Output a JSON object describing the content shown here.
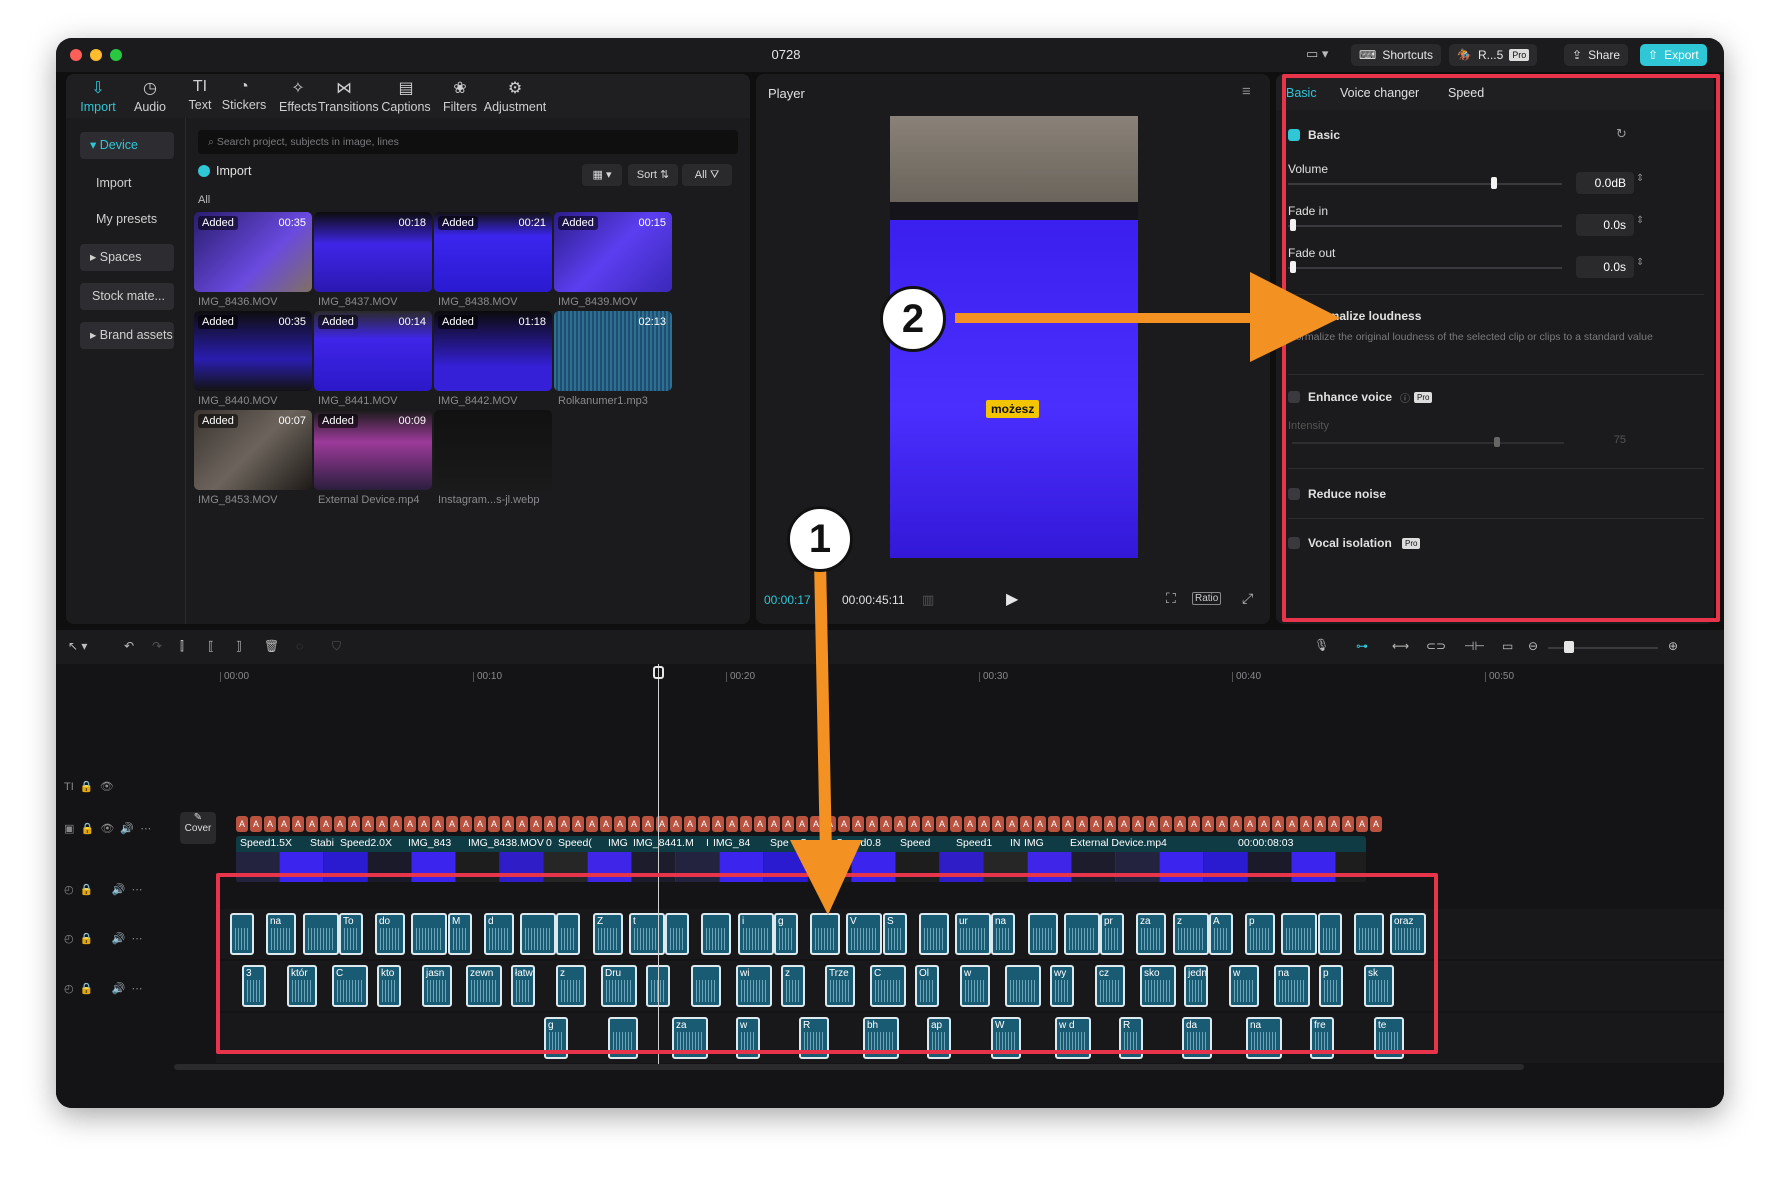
{
  "window": {
    "title": "0728",
    "shortcuts": "Shortcuts",
    "project": "R...5",
    "pro": "Pro",
    "share": "Share",
    "export": "Export"
  },
  "toolbar": [
    {
      "label": "Import",
      "icon": "import-icon",
      "active": true
    },
    {
      "label": "Audio",
      "icon": "audio-icon"
    },
    {
      "label": "Text",
      "icon": "text-icon"
    },
    {
      "label": "Stickers",
      "icon": "stickers-icon"
    },
    {
      "label": "Effects",
      "icon": "effects-icon"
    },
    {
      "label": "Transitions",
      "icon": "transitions-icon"
    },
    {
      "label": "Captions",
      "icon": "captions-icon"
    },
    {
      "label": "Filters",
      "icon": "filters-icon"
    },
    {
      "label": "Adjustment",
      "icon": "adjustment-icon"
    }
  ],
  "sidebar": {
    "device": "Device",
    "import": "Import",
    "presets": "My presets",
    "spaces": "Spaces",
    "stock": "Stock mate...",
    "brand": "Brand assets"
  },
  "media": {
    "search_placeholder": "Search project, subjects in image, lines",
    "import": "Import",
    "sort": "Sort",
    "all": "All",
    "all_label": "All",
    "added": "Added",
    "items": [
      {
        "name": "IMG_8436.MOV",
        "dur": "00:35",
        "added": true
      },
      {
        "name": "IMG_8437.MOV",
        "dur": "00:18",
        "added": false
      },
      {
        "name": "IMG_8438.MOV",
        "dur": "00:21",
        "added": true
      },
      {
        "name": "IMG_8439.MOV",
        "dur": "00:15",
        "added": true
      },
      {
        "name": "IMG_8440.MOV",
        "dur": "00:35",
        "added": true
      },
      {
        "name": "IMG_8441.MOV",
        "dur": "00:14",
        "added": true
      },
      {
        "name": "IMG_8442.MOV",
        "dur": "01:18",
        "added": true
      },
      {
        "name": "Rolkanumer1.mp3",
        "dur": "02:13",
        "added": false
      },
      {
        "name": "IMG_8453.MOV",
        "dur": "00:07",
        "added": true
      },
      {
        "name": "External Device.mp4",
        "dur": "00:09",
        "added": true
      },
      {
        "name": "Instagram...s-jl.webp",
        "dur": "",
        "added": false
      }
    ]
  },
  "player": {
    "title": "Player",
    "current": "00:00:17:07",
    "current_shown": "00:00:17",
    "current_tail": "7",
    "total": "00:00:45:11",
    "caption": "możesz",
    "ratio": "Ratio"
  },
  "props": {
    "tabs": [
      "Basic",
      "Voice changer",
      "Speed"
    ],
    "basic": "Basic",
    "volume_label": "Volume",
    "volume_value": "0.0dB",
    "volume_level": 0.75,
    "fadein_label": "Fade in",
    "fadein_value": "0.0s",
    "fadeout_label": "Fade out",
    "fadeout_value": "0.0s",
    "normalize": "Normalize loudness",
    "normalize_desc": "Normalize the original loudness of the selected clip or clips to a standard value",
    "enhance": "Enhance voice",
    "intensity": "Intensity",
    "intensity_value": "75",
    "reduce": "Reduce noise",
    "vocal": "Vocal isolation",
    "pro": "Pro"
  },
  "timeline": {
    "ruler": [
      "00:00",
      "00:10",
      "00:20",
      "00:30",
      "00:40",
      "00:50"
    ],
    "cover": "Cover",
    "video_labels": [
      "Speed1.5X",
      "Stabi",
      "Speed2.0X",
      "IMG_843",
      "IMG_8438.MOV",
      "0",
      "Speed(",
      "IMG",
      "IMG_8441.M",
      "I",
      "IMG_84",
      "Spe",
      "Spe",
      "Speed0.8",
      "Speed",
      "Speed1",
      "IN",
      "IMG",
      "External Device.mp4",
      "00:00:08:03"
    ],
    "audio1_labels": [
      "",
      "na",
      "",
      "To",
      "do",
      "",
      "M",
      "d",
      "",
      "",
      "Z",
      "t",
      "",
      "",
      "i",
      "g",
      "",
      "V",
      "S",
      "",
      "ur",
      "na",
      "",
      "",
      "pr",
      "za",
      "z",
      "A",
      "p",
      "",
      "",
      "",
      "oraz"
    ],
    "audio2_labels": [
      "3",
      "któr",
      "C",
      "kto",
      "jasn",
      "zewn",
      "łatw",
      "z",
      "Dru",
      "",
      "",
      "wi",
      "z",
      "Trze",
      "C",
      "Ol",
      "w",
      "",
      "wy",
      "cz",
      "sko",
      "jedn",
      "w",
      "na",
      "p",
      "sk"
    ],
    "audio3_labels": [
      "g",
      "",
      "za",
      "w",
      "R",
      "bh",
      "ap",
      "W",
      "w d",
      "R",
      "da",
      "na",
      "fre",
      "te"
    ]
  },
  "annotations": [
    "1",
    "2"
  ]
}
